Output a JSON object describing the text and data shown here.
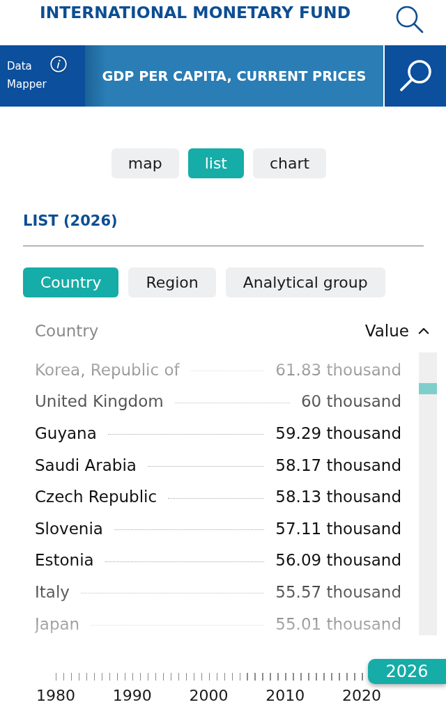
{
  "header": {
    "title": "INTERNATIONAL MONETARY FUND"
  },
  "banner": {
    "app_name": "Data Mapper",
    "indicator": "GDP PER CAPITA, CURRENT PRICES"
  },
  "view_tabs": [
    {
      "label": "map",
      "selected": false
    },
    {
      "label": "list",
      "selected": true
    },
    {
      "label": "chart",
      "selected": false
    }
  ],
  "list_title": "LIST (2026)",
  "group_tabs": [
    {
      "label": "Country",
      "selected": true
    },
    {
      "label": "Region",
      "selected": false
    },
    {
      "label": "Analytical group",
      "selected": false
    }
  ],
  "table": {
    "columns": [
      "Country",
      "Value"
    ],
    "rows": [
      {
        "name": "Korea, Republic of",
        "value": "61.83 thousand"
      },
      {
        "name": "United Kingdom",
        "value": "60 thousand"
      },
      {
        "name": "Guyana",
        "value": "59.29 thousand"
      },
      {
        "name": "Saudi Arabia",
        "value": "58.17 thousand"
      },
      {
        "name": "Czech Republic",
        "value": "58.13 thousand"
      },
      {
        "name": "Slovenia",
        "value": "57.11 thousand"
      },
      {
        "name": "Estonia",
        "value": "56.09 thousand"
      },
      {
        "name": "Italy",
        "value": "55.57 thousand"
      },
      {
        "name": "Japan",
        "value": "55.01 thousand"
      }
    ]
  },
  "timeline": {
    "labels": [
      "1980",
      "1990",
      "2000",
      "2010",
      "2020"
    ],
    "handle": "2026",
    "level": 1
  }
}
